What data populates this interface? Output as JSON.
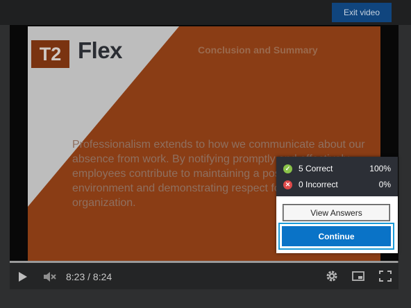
{
  "header": {
    "exit_label": "Exit video"
  },
  "slide": {
    "logo_mark": "T2",
    "logo_text": "Flex",
    "title": "Conclusion and Summary",
    "body_lines": [
      "Professionalism extends to how we communicate about our",
      "absence from work. By notifying promptly and effectively,",
      "employees contribute to maintaining a positive work",
      "environment and demonstrating respect for the",
      "organization."
    ]
  },
  "quiz": {
    "correct_label": "5 Correct",
    "correct_pct": "100%",
    "incorrect_label": "0 Incorrect",
    "incorrect_pct": "0%",
    "view_answers_label": "View Answers",
    "continue_label": "Continue"
  },
  "player": {
    "time": "8:23 / 8:24",
    "progress_fraction": 0.998,
    "icons": [
      "play-icon",
      "mute-icon",
      "settings-icon",
      "pip-icon",
      "fullscreen-icon"
    ]
  },
  "colors": {
    "slide_orange": "#8a3d15",
    "continue_blue": "#0a73c7",
    "focus_ring": "#1a9bd8",
    "exit_blue": "#10457e"
  }
}
